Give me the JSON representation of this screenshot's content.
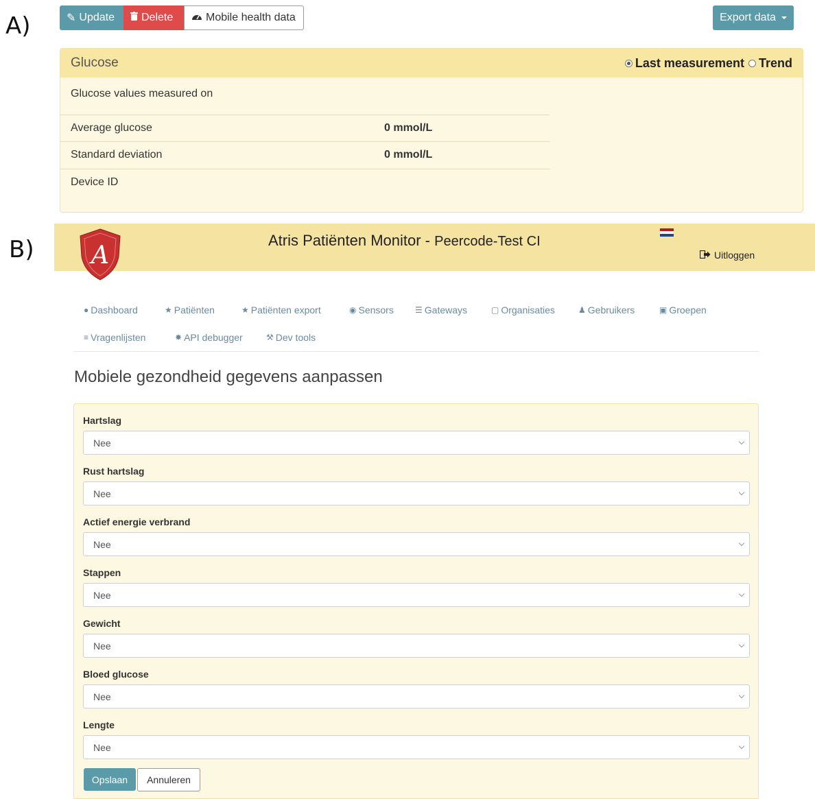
{
  "labels": {
    "panel_a": "A)",
    "panel_b": "B)"
  },
  "panel_a": {
    "toolbar": {
      "update": "Update",
      "delete": "Delete",
      "mobile_health": "Mobile health data",
      "export": "Export data"
    },
    "glucose": {
      "title": "Glucose",
      "radio_last": "Last measurement",
      "radio_trend": "Trend",
      "selected": "Last measurement",
      "measured_on_label": "Glucose values measured on",
      "rows": [
        {
          "label": "Average glucose",
          "value": "0 mmol/L"
        },
        {
          "label": "Standard deviation",
          "value": "0 mmol/L"
        },
        {
          "label": "Device ID",
          "value": ""
        }
      ]
    }
  },
  "panel_b": {
    "header": {
      "app_name": "Atris Patiënten Monitor",
      "separator": " - ",
      "tenant": "Peercode-Test CI",
      "logout": "Uitloggen",
      "brand_color": "#c8312f",
      "bar_color": "#f5e3a1"
    },
    "nav": [
      {
        "label": "Dashboard",
        "icon": "tachometer-icon"
      },
      {
        "label": "Patiënten",
        "icon": "users-icon"
      },
      {
        "label": "Patiënten export",
        "icon": "users-icon"
      },
      {
        "label": "Sensors",
        "icon": "sensor-icon"
      },
      {
        "label": "Gateways",
        "icon": "list-icon"
      },
      {
        "label": "Organisaties",
        "icon": "clipboard-icon"
      },
      {
        "label": "Gebruikers",
        "icon": "user-icon"
      },
      {
        "label": "Groepen",
        "icon": "briefcase-icon"
      },
      {
        "label": "Vragenlijsten",
        "icon": "list-ordered-icon"
      },
      {
        "label": "API debugger",
        "icon": "bug-icon"
      },
      {
        "label": "Dev tools",
        "icon": "wrench-icon"
      }
    ],
    "page_title": "Mobiele gezondheid gegevens aanpassen",
    "fields": [
      {
        "label": "Hartslag",
        "value": "Nee"
      },
      {
        "label": "Rust hartslag",
        "value": "Nee"
      },
      {
        "label": "Actief energie verbrand",
        "value": "Nee"
      },
      {
        "label": "Stappen",
        "value": "Nee"
      },
      {
        "label": "Gewicht",
        "value": "Nee"
      },
      {
        "label": "Bloed glucose",
        "value": "Nee"
      },
      {
        "label": "Lengte",
        "value": "Nee"
      }
    ],
    "buttons": {
      "save": "Opslaan",
      "cancel": "Annuleren"
    }
  }
}
